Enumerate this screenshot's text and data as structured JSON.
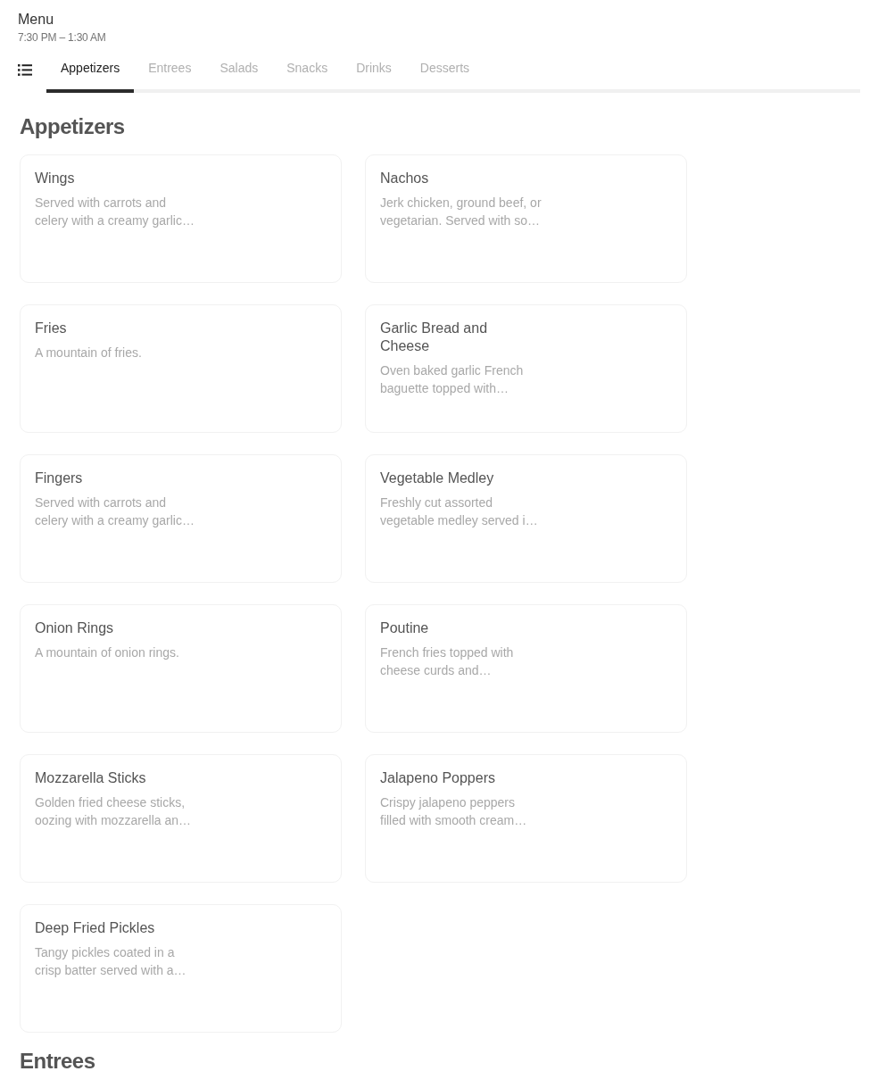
{
  "header": {
    "title": "Menu",
    "hours": "7:30 PM – 1:30 AM"
  },
  "tabs": [
    {
      "label": "Appetizers",
      "selected": true
    },
    {
      "label": "Entrees",
      "selected": false
    },
    {
      "label": "Salads",
      "selected": false
    },
    {
      "label": "Snacks",
      "selected": false
    },
    {
      "label": "Drinks",
      "selected": false
    },
    {
      "label": "Desserts",
      "selected": false
    }
  ],
  "sections": [
    {
      "title": "Appetizers",
      "items": [
        {
          "name": "Wings",
          "description": "Served with carrots and celery with a creamy garlic…"
        },
        {
          "name": "Nachos",
          "description": "Jerk chicken, ground beef, or vegetarian. Served with so…"
        },
        {
          "name": "Fries",
          "description": "A mountain of fries."
        },
        {
          "name": "Garlic Bread and Cheese",
          "description": "Oven baked garlic French baguette topped with…"
        },
        {
          "name": "Fingers",
          "description": "Served with carrots and celery with a creamy garlic…"
        },
        {
          "name": "Vegetable Medley",
          "description": "Freshly cut assorted vegetable medley served i…"
        },
        {
          "name": "Onion Rings",
          "description": "A mountain of onion rings."
        },
        {
          "name": "Poutine",
          "description": "French fries topped with cheese curds and…"
        },
        {
          "name": "Mozzarella Sticks",
          "description": "Golden fried cheese sticks, oozing with mozzarella an…"
        },
        {
          "name": "Jalapeno Poppers",
          "description": "Crispy jalapeno peppers filled with smooth cream…"
        },
        {
          "name": "Deep Fried Pickles",
          "description": "Tangy pickles coated in a crisp batter served with a…"
        }
      ]
    },
    {
      "title": "Entrees"
    }
  ]
}
